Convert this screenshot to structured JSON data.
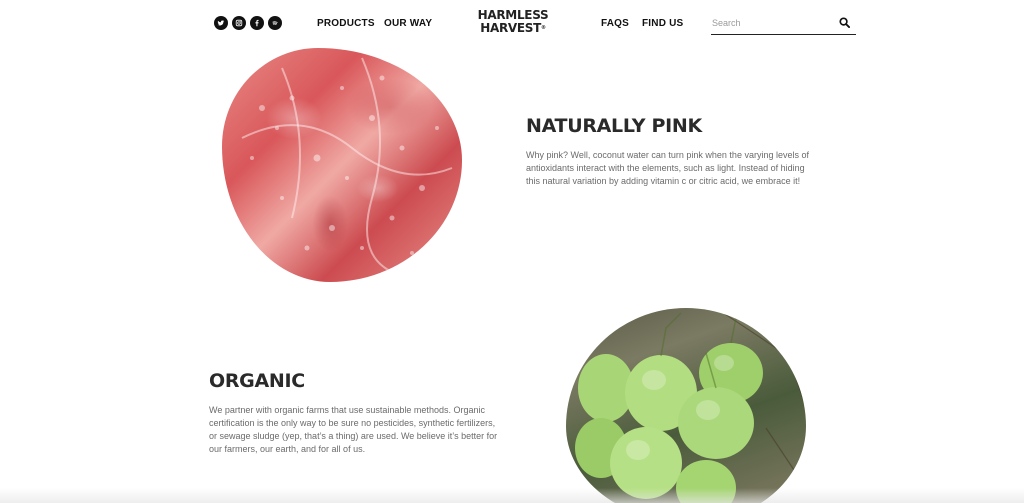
{
  "header": {
    "social": [
      {
        "icon": "twitter-icon"
      },
      {
        "icon": "instagram-icon"
      },
      {
        "icon": "facebook-icon"
      },
      {
        "icon": "spotify-icon"
      }
    ],
    "nav_left": [
      {
        "label": "PRODUCTS"
      },
      {
        "label": "OUR WAY"
      }
    ],
    "logo": {
      "line1": "HARMLESS",
      "line2": "HARVEST",
      "reg": "®"
    },
    "nav_right": [
      {
        "label": "FAQS"
      },
      {
        "label": "FIND US"
      }
    ],
    "search": {
      "placeholder": "Search",
      "icon": "search-icon"
    }
  },
  "sections": [
    {
      "heading": "NATURALLY PINK",
      "body": "Why pink? Well, coconut water can turn pink when the varying levels of antioxidants interact with the elements, such as light. Instead of hiding this natural variation by adding vitamin c or citric acid, we embrace it!",
      "image": "pink-coconut-water-ice-image"
    },
    {
      "heading": "ORGANIC",
      "body": "We partner with organic farms that use sustainable methods. Organic certification is the only way to be sure no pesticides, synthetic fertilizers, or sewage sludge (yep, that’s a thing) are used. We believe it’s better for our farmers, our earth, and for all of us.",
      "image": "green-coconuts-image"
    }
  ],
  "colors": {
    "text_dark": "#222222",
    "body_gray": "#6b6b6b",
    "pink": "#d9575a",
    "coconut_green": "#9fd06a"
  }
}
